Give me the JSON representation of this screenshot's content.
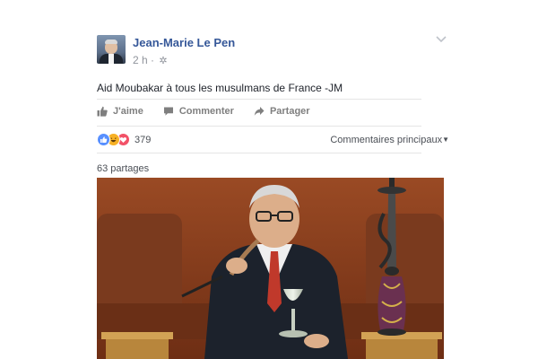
{
  "post": {
    "author": "Jean-Marie Le Pen",
    "time": "2 h",
    "privacy_icon": "gear-icon",
    "options_icon": "chevron-down-icon",
    "text": "Aid Moubakar à tous les musulmans de France -JM",
    "photo_description": "photo-sepia-man-with-hookah"
  },
  "actions": {
    "like_label": "J'aime",
    "comment_label": "Commenter",
    "share_label": "Partager"
  },
  "stats": {
    "reactions": [
      "like",
      "haha",
      "love"
    ],
    "reaction_count": "379",
    "comments_order": "Commentaires principaux",
    "shares": "63 partages"
  },
  "colors": {
    "link_blue": "#365899",
    "like_blue": "#5890ff",
    "haha_yellow": "#f7b125",
    "love_red": "#f25268"
  }
}
